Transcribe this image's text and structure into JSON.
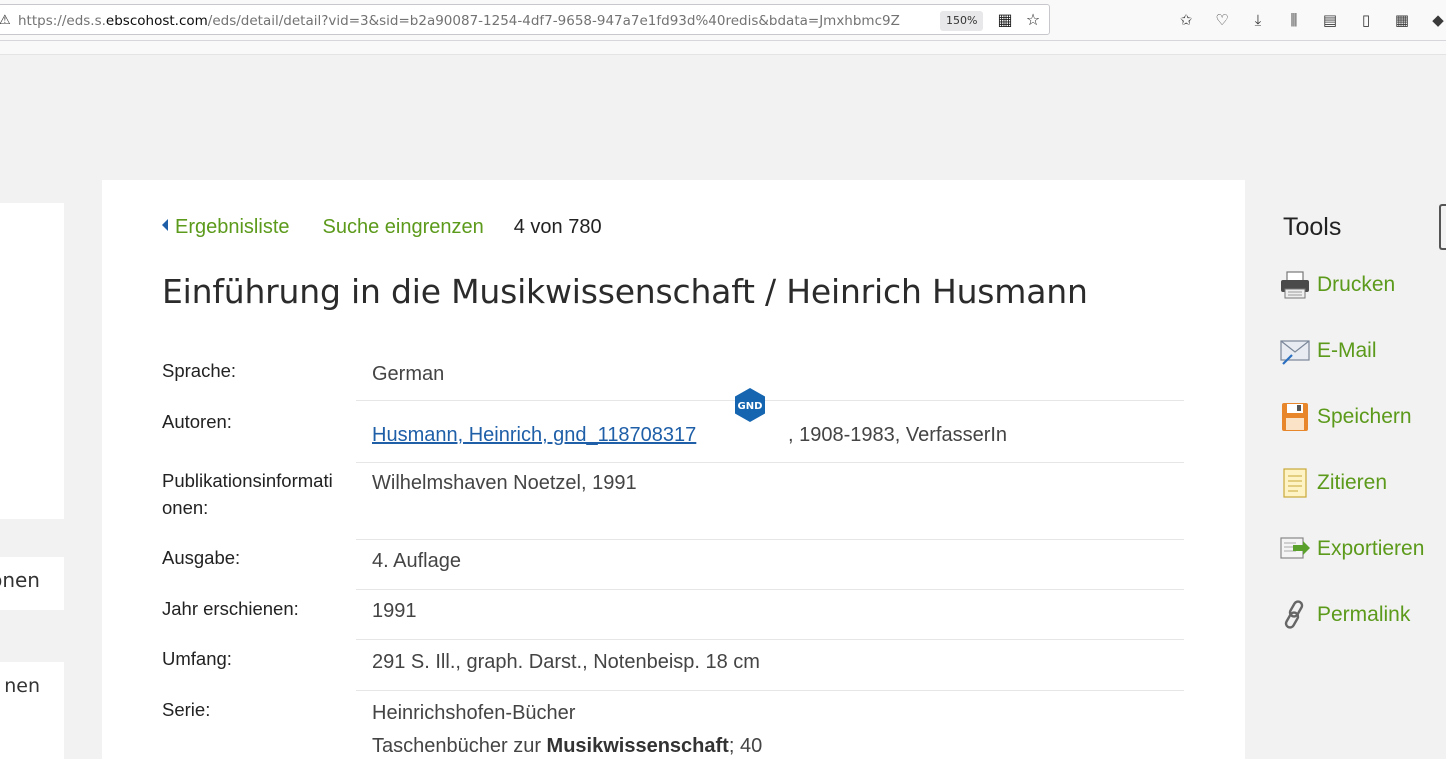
{
  "browser": {
    "url_prefix": "https://eds.s.",
    "url_domain": "ebscohost.com",
    "url_rest": "/eds/detail/detail?vid=3&sid=b2a90087-1254-4df7-9658-947a7e1fd93d%40redis&bdata=Jmxhbmc9Z",
    "zoom": "150%"
  },
  "left_panels": {
    "panel2_text": "onen",
    "panel3_text": "nen"
  },
  "nav": {
    "back_label": "Ergebnisliste",
    "refine_label": "Suche eingrenzen",
    "position": "4 von 780"
  },
  "record": {
    "title": "Einführung in die Musikwissenschaft / Heinrich Husmann",
    "fields": {
      "sprache": {
        "label": "Sprache:",
        "value": "German"
      },
      "autoren": {
        "label": "Autoren:",
        "link": "Husmann, Heinrich, gnd_118708317",
        "badge": "GND",
        "suffix": ", 1908-1983, VerfasserIn"
      },
      "publikation": {
        "label": "Publikationsinformationen:",
        "label_line1": "Publikationsinformati",
        "label_line2": "onen:",
        "value": "Wilhelmshaven Noetzel, 1991"
      },
      "ausgabe": {
        "label": "Ausgabe:",
        "value": "4. Auflage"
      },
      "jahr": {
        "label": "Jahr erschienen:",
        "value": "1991"
      },
      "umfang": {
        "label": "Umfang:",
        "value": "291 S. Ill., graph. Darst., Notenbeisp. 18 cm"
      },
      "serie": {
        "label": "Serie:",
        "value_line1": "Heinrichshofen-Bücher",
        "value_line2_a": "Taschenbücher zur ",
        "value_line2_b": "Musikwissenschaft",
        "value_line2_c": "; 40"
      }
    }
  },
  "tools": {
    "title": "Tools",
    "items": [
      {
        "label": "Drucken",
        "icon": "printer-icon"
      },
      {
        "label": "E-Mail",
        "icon": "email-icon"
      },
      {
        "label": "Speichern",
        "icon": "save-icon"
      },
      {
        "label": "Zitieren",
        "icon": "cite-icon"
      },
      {
        "label": "Exportieren",
        "icon": "export-icon"
      },
      {
        "label": "Permalink",
        "icon": "permalink-icon"
      }
    ]
  },
  "colors": {
    "link_green": "#5c9a1b",
    "author_blue": "#1f5fa8",
    "gnd_badge": "#1565b0"
  }
}
